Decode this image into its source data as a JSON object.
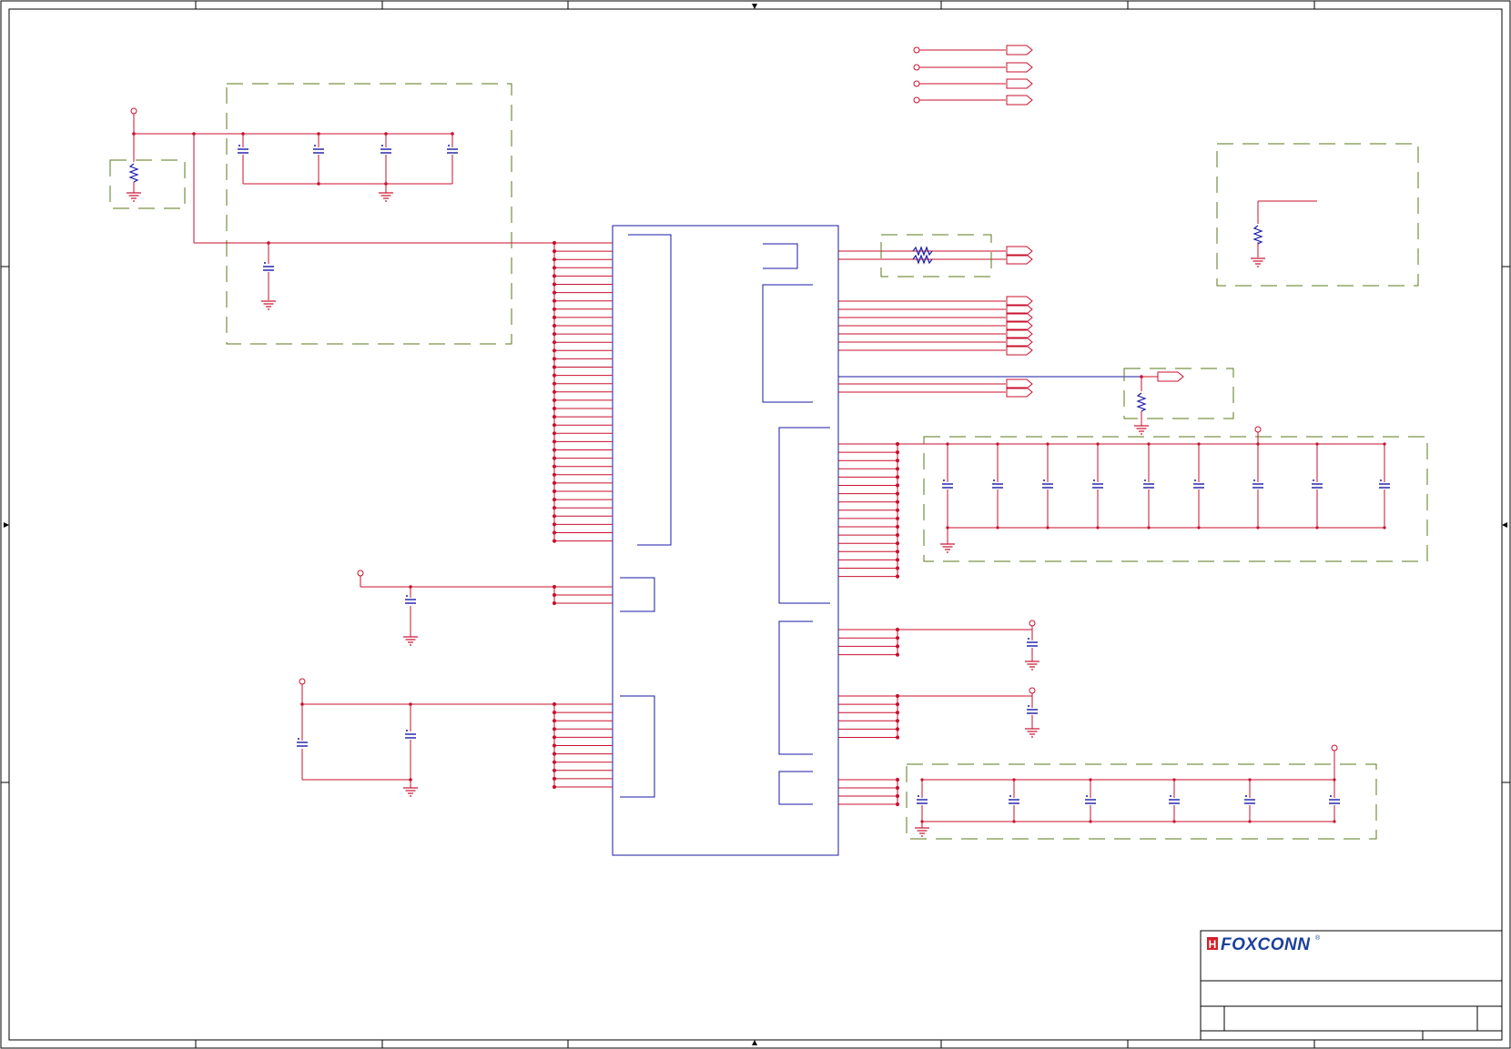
{
  "title_block": {
    "logo_text": "FOXCONN",
    "logo_mark": "H",
    "registered_mark": "®"
  },
  "colors": {
    "border": "#000000",
    "wire": "#c8102e",
    "part": "#1a1aa6",
    "group_box": "#5a7a1a",
    "logo_red": "#d4202a",
    "logo_blue": "#1b3f9c"
  },
  "icons": [
    "ground-symbol-icon",
    "power-port-icon",
    "off-page-connector-icon",
    "capacitor-icon",
    "resistor-icon"
  ]
}
